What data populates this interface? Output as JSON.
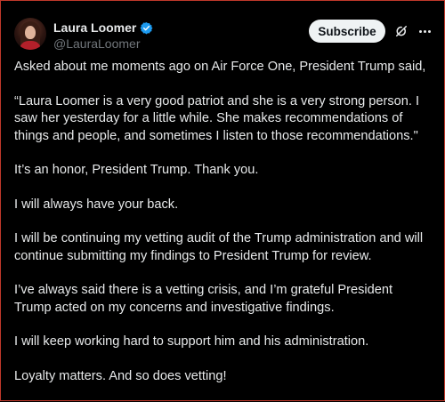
{
  "author": {
    "display_name": "Laura Loomer",
    "handle": "@LauraLoomer",
    "verified_color": "#1d9bf0"
  },
  "actions": {
    "subscribe_label": "Subscribe",
    "grok_icon": "grok-icon",
    "more_icon": "more-options-icon"
  },
  "post": {
    "paragraphs": [
      "Asked about me moments ago on Air Force One, President Trump said,",
      "“Laura Loomer is a very good patriot and she is a very strong person. I saw her yesterday for a little while. She makes recommendations of things and people, and sometimes I listen to those recommendations.\"",
      "It’s an honor, President Trump. Thank you.",
      "I will always have your back.",
      "I will be continuing my vetting audit of the Trump administration and will continue submitting my findings to President Trump for review.",
      "I’ve always said there is a vetting crisis, and I’m grateful President Trump acted on my concerns and investigative findings.",
      "I will keep working hard to support him and his administration.",
      "Loyalty matters. And so does vetting!"
    ]
  },
  "colors": {
    "background": "#000000",
    "text": "#e7e9ea",
    "secondary_text": "#71767b",
    "subscribe_bg": "#eff3f4",
    "frame_border": "#c0392b"
  }
}
